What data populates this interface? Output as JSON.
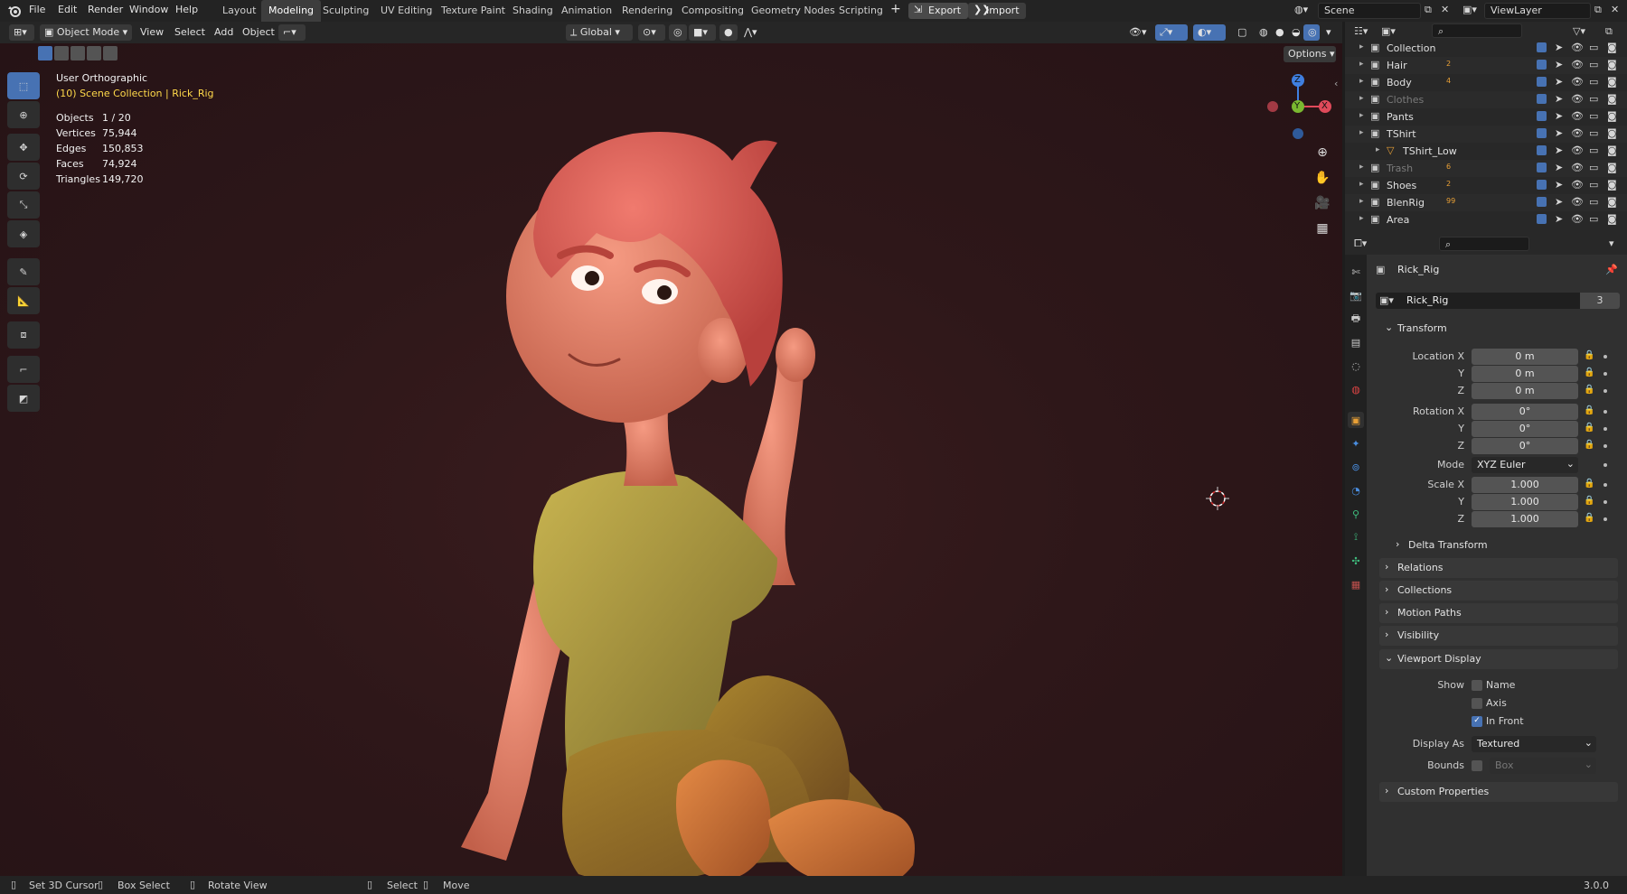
{
  "topmenu": [
    "File",
    "Edit",
    "Render",
    "Window",
    "Help"
  ],
  "workspaces": [
    "Layout",
    "Modeling",
    "Sculpting",
    "UV Editing",
    "Texture Paint",
    "Shading",
    "Animation",
    "Rendering",
    "Compositing",
    "Geometry Nodes",
    "Scripting"
  ],
  "active_workspace": "Modeling",
  "add_workspace": "+",
  "export_label": "Export",
  "import_label": "Import",
  "scene_name": "Scene",
  "view_layer": "ViewLayer",
  "viewport": {
    "mode": "Object Mode",
    "menus": [
      "View",
      "Select",
      "Add",
      "Object"
    ],
    "transform_orientation": "Global",
    "options_label": "Options",
    "view_name": "User Orthographic",
    "collection_path": "(10) Scene Collection | Rick_Rig",
    "stats": [
      {
        "label": "Objects",
        "value": "1 / 20"
      },
      {
        "label": "Vertices",
        "value": "75,944"
      },
      {
        "label": "Edges",
        "value": "150,853"
      },
      {
        "label": "Faces",
        "value": "74,924"
      },
      {
        "label": "Triangles",
        "value": "149,720"
      }
    ],
    "gizmo": {
      "z": "Z",
      "y": "Y",
      "x": "X"
    }
  },
  "outliner": {
    "rows": [
      {
        "name": "Collection",
        "dim": false
      },
      {
        "name": "Hair",
        "dim": false,
        "badge": "2"
      },
      {
        "name": "Body",
        "dim": false,
        "badge": "4"
      },
      {
        "name": "Clothes",
        "dim": true
      },
      {
        "name": "Pants",
        "dim": false
      },
      {
        "name": "TShirt",
        "dim": false
      },
      {
        "name": "TShirt_Low",
        "dim": false,
        "child": true
      },
      {
        "name": "Trash",
        "dim": true,
        "badge": "6"
      },
      {
        "name": "Shoes",
        "dim": false,
        "badge": "2"
      },
      {
        "name": "BlenRig",
        "dim": false,
        "badge": "99"
      },
      {
        "name": "Area",
        "dim": false
      }
    ]
  },
  "properties": {
    "object_name": "Rick_Rig",
    "data_name": "Rick_Rig",
    "users": "3",
    "transform_label": "Transform",
    "location": [
      {
        "label": "Location X",
        "value": "0 m"
      },
      {
        "label": "Y",
        "value": "0 m"
      },
      {
        "label": "Z",
        "value": "0 m"
      }
    ],
    "rotation": [
      {
        "label": "Rotation X",
        "value": "0°"
      },
      {
        "label": "Y",
        "value": "0°"
      },
      {
        "label": "Z",
        "value": "0°"
      }
    ],
    "mode_label": "Mode",
    "mode_value": "XYZ Euler",
    "scale": [
      {
        "label": "Scale X",
        "value": "1.000"
      },
      {
        "label": "Y",
        "value": "1.000"
      },
      {
        "label": "Z",
        "value": "1.000"
      }
    ],
    "delta_transform": "Delta Transform",
    "panels": [
      "Relations",
      "Collections",
      "Motion Paths",
      "Visibility"
    ],
    "viewport_display": "Viewport Display",
    "show_label": "Show",
    "show_name": "Name",
    "show_axis": "Axis",
    "show_in_front": "In Front",
    "display_as_label": "Display As",
    "display_as_value": "Textured",
    "bounds_label": "Bounds",
    "bounds_value": "Box",
    "custom_properties": "Custom Properties"
  },
  "status": {
    "items": [
      "Set 3D Cursor",
      "Box Select",
      "Rotate View",
      "Select",
      "Move"
    ],
    "version": "3.0.0"
  },
  "colors": {
    "accent": "#4772b3",
    "header": "#232323",
    "panel": "#303030",
    "viewport": "#2e1719"
  }
}
